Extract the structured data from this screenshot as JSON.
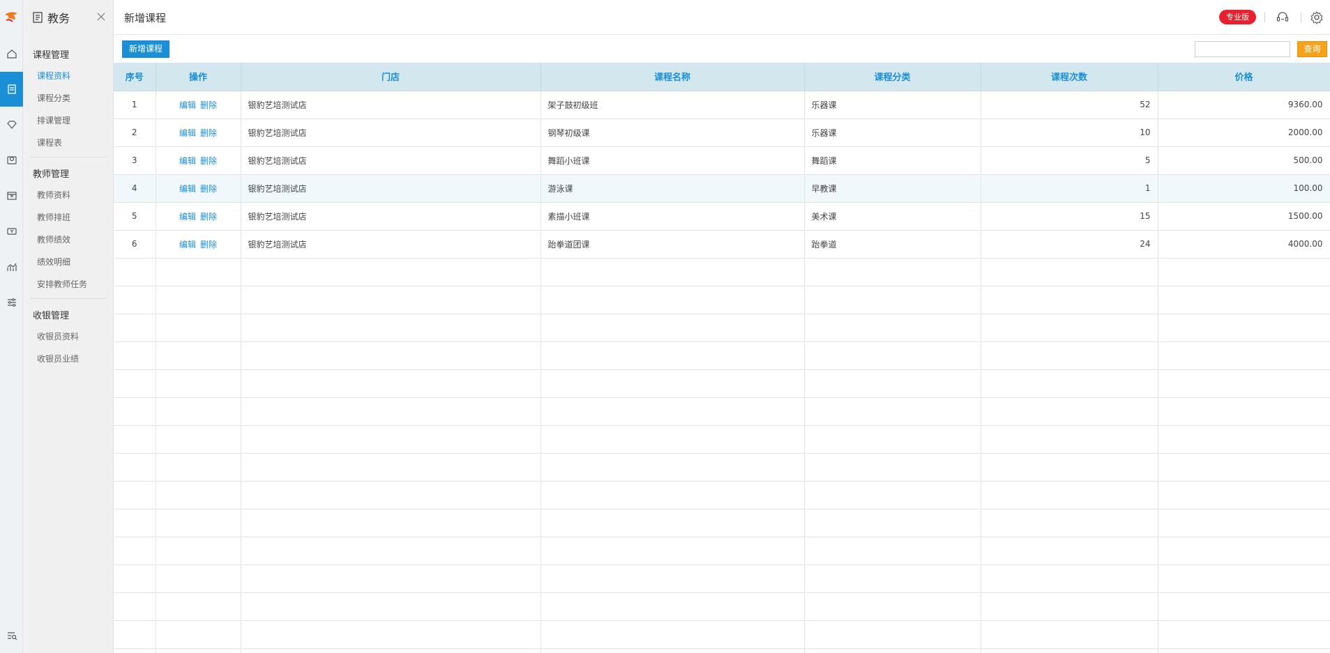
{
  "sidebar": {
    "title": "教务",
    "groups": [
      {
        "label": "课程管理",
        "items": [
          "课程资料",
          "课程分类",
          "排课管理",
          "课程表"
        ]
      },
      {
        "label": "教师管理",
        "items": [
          "教师资料",
          "教师排班",
          "教师绩效",
          "绩效明细",
          "安排教师任务"
        ]
      },
      {
        "label": "收银管理",
        "items": [
          "收银员资料",
          "收银员业绩"
        ]
      }
    ],
    "active_item": "课程资料"
  },
  "header": {
    "title": "新增课程",
    "badge": "专业版"
  },
  "toolbar": {
    "add_label": "新增课程",
    "search_value": "",
    "query_label": "查询"
  },
  "table": {
    "columns": [
      "序号",
      "操作",
      "门店",
      "课程名称",
      "课程分类",
      "课程次数",
      "价格"
    ],
    "action_edit": "编辑",
    "action_delete": "删除",
    "rows": [
      {
        "no": "1",
        "store": "银豹艺培测试店",
        "name": "架子鼓初级班",
        "category": "乐器课",
        "count": "52",
        "price": "9360.00"
      },
      {
        "no": "2",
        "store": "银豹艺培测试店",
        "name": "钢琴初级课",
        "category": "乐器课",
        "count": "10",
        "price": "2000.00"
      },
      {
        "no": "3",
        "store": "银豹艺培测试店",
        "name": "舞蹈小班课",
        "category": "舞蹈课",
        "count": "5",
        "price": "500.00"
      },
      {
        "no": "4",
        "store": "银豹艺培测试店",
        "name": "游泳课",
        "category": "早教课",
        "count": "1",
        "price": "100.00"
      },
      {
        "no": "5",
        "store": "银豹艺培测试店",
        "name": "素描小班课",
        "category": "美术课",
        "count": "15",
        "price": "1500.00"
      },
      {
        "no": "6",
        "store": "银豹艺培测试店",
        "name": "跆拳道团课",
        "category": "跆拳道",
        "count": "24",
        "price": "4000.00"
      }
    ]
  },
  "colors": {
    "accent": "#1a8fd6",
    "badge": "#e8202e",
    "query": "#f7a21b",
    "header_bg": "#d3e7ee"
  }
}
